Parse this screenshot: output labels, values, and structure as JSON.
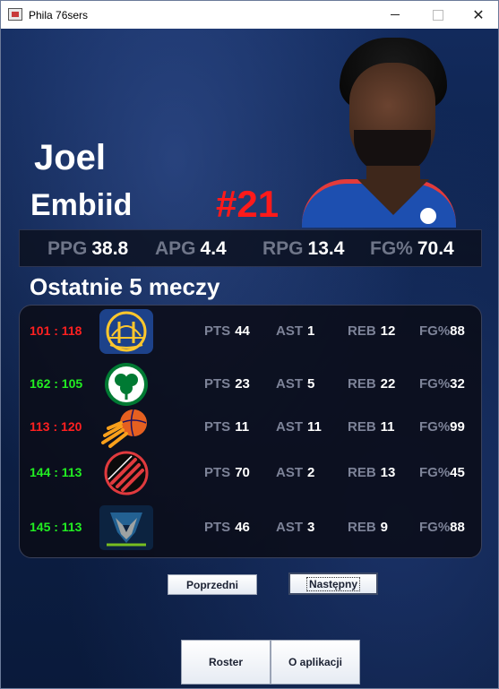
{
  "window": {
    "title": "Phila 76sers",
    "minimize_label": "",
    "maximize_label": "",
    "close_label": "✕"
  },
  "player": {
    "first_name": "Joel",
    "last_name": "Embiid",
    "number": "#21"
  },
  "season_stats": [
    {
      "key": "PPG",
      "value": "38.8"
    },
    {
      "key": "APG",
      "value": "4.4"
    },
    {
      "key": "RPG",
      "value": "13.4"
    },
    {
      "key": "FG%",
      "value": "70.4"
    }
  ],
  "section_title": "Ostatnie 5 meczy",
  "games": [
    {
      "score": "101 : 118",
      "result": "loss",
      "opponent_icon": "golden-state-warriors-logo-icon",
      "pts_label": "PTS",
      "pts": "44",
      "ast_label": "AST",
      "ast": "1",
      "reb_label": "REB",
      "reb": "12",
      "fg_label": "FG%",
      "fg": "88"
    },
    {
      "score": "162 : 105",
      "result": "win",
      "opponent_icon": "boston-celtics-logo-icon",
      "pts_label": "PTS",
      "pts": "23",
      "ast_label": "AST",
      "ast": "5",
      "reb_label": "REB",
      "reb": "22",
      "fg_label": "FG%",
      "fg": "32"
    },
    {
      "score": "113 : 120",
      "result": "loss",
      "opponent_icon": "phoenix-suns-logo-icon",
      "pts_label": "PTS",
      "pts": "11",
      "ast_label": "AST",
      "ast": "11",
      "reb_label": "REB",
      "reb": "11",
      "fg_label": "FG%",
      "fg": "99"
    },
    {
      "score": "144 : 113",
      "result": "win",
      "opponent_icon": "portland-trail-blazers-logo-icon",
      "pts_label": "PTS",
      "pts": "70",
      "ast_label": "AST",
      "ast": "2",
      "reb_label": "REB",
      "reb": "13",
      "fg_label": "FG%",
      "fg": "45"
    },
    {
      "score": "145 : 113",
      "result": "win",
      "opponent_icon": "minnesota-timberwolves-logo-icon",
      "pts_label": "PTS",
      "pts": "46",
      "ast_label": "AST",
      "ast": "3",
      "reb_label": "REB",
      "reb": "9",
      "fg_label": "FG%",
      "fg": "88"
    }
  ],
  "buttons": {
    "previous": "Poprzedni",
    "next": "Następny",
    "roster": "Roster",
    "about": "O aplikacji"
  },
  "colors": {
    "win": "#22ee22",
    "loss": "#ff2020",
    "number": "#ff1a1a",
    "stat_key": "#6f7689"
  }
}
